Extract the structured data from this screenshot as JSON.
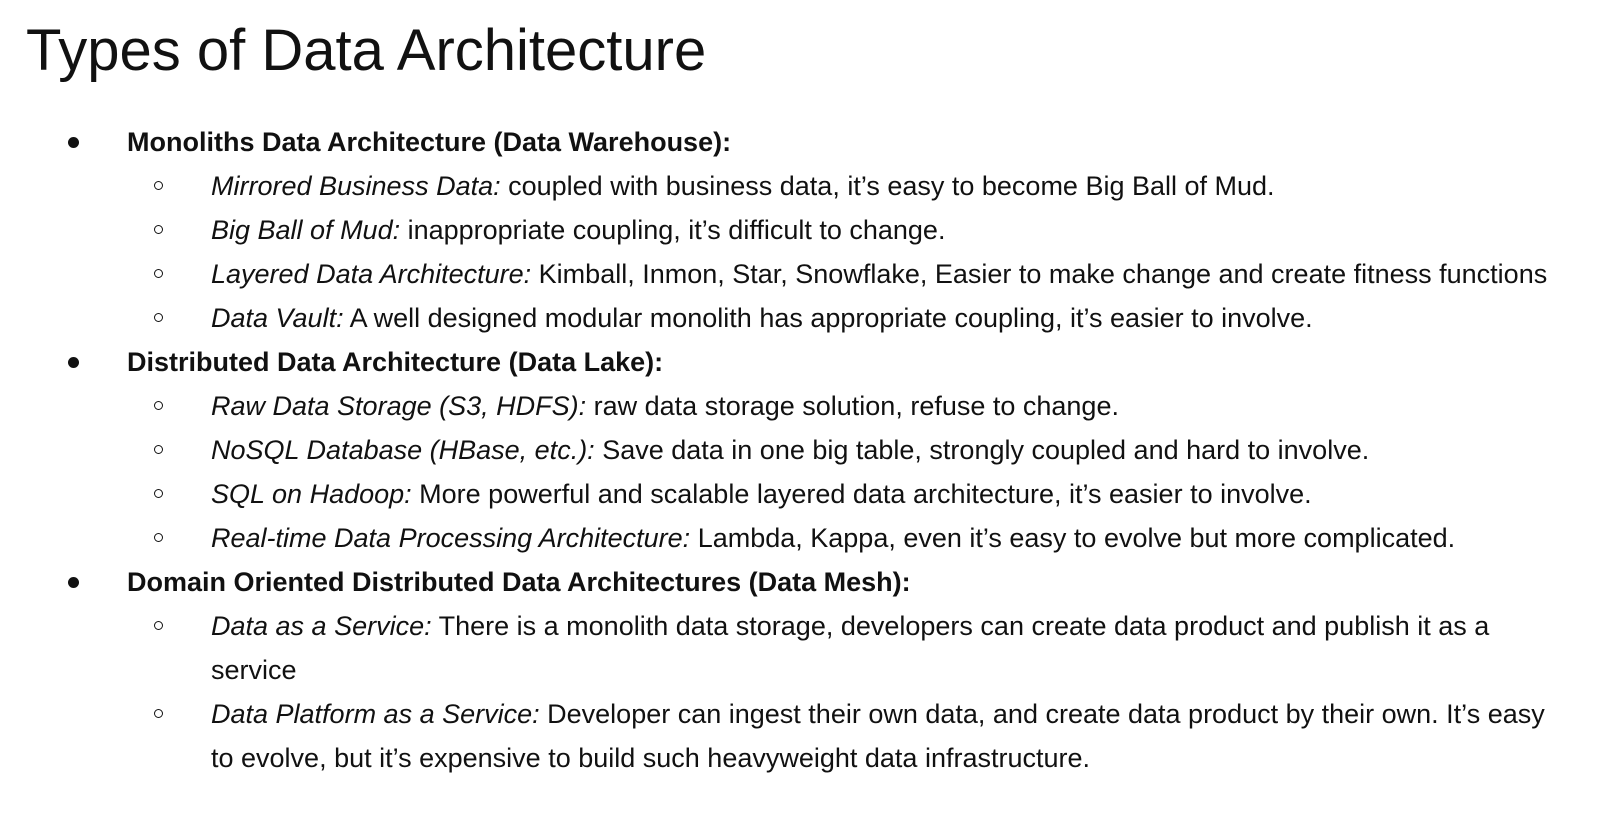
{
  "title": "Types of Data Architecture",
  "sections": [
    {
      "heading": "Monoliths Data Architecture (Data Warehouse):",
      "items": [
        {
          "term": "Mirrored Business Data:",
          "desc": " coupled with business data, it’s easy to become Big Ball of Mud."
        },
        {
          "term": "Big Ball of Mud:",
          "desc": " inappropriate coupling, it’s difficult to change."
        },
        {
          "term": "Layered Data Architecture:",
          "desc": " Kimball, Inmon, Star, Snowflake, Easier to make change and create fitness functions"
        },
        {
          "term": "Data Vault:",
          "desc": " A well designed modular monolith has appropriate coupling, it’s easier to involve."
        }
      ]
    },
    {
      "heading": "Distributed Data Architecture (Data Lake):",
      "items": [
        {
          "term": "Raw Data Storage (S3, HDFS):",
          "desc": " raw data storage solution, refuse to change."
        },
        {
          "term": "NoSQL Database (HBase, etc.):",
          "desc": " Save data in one big table, strongly coupled and hard to involve."
        },
        {
          "term": "SQL on Hadoop:",
          "desc": " More powerful and scalable layered data architecture, it’s easier to involve."
        },
        {
          "term": "Real-time Data Processing Architecture:",
          "desc": " Lambda, Kappa, even it’s easy to evolve but more complicated."
        }
      ]
    },
    {
      "heading": "Domain Oriented Distributed Data Architectures (Data Mesh):",
      "items": [
        {
          "term": "Data as a Service:",
          "desc": " There is a monolith data storage, developers can create data product and publish it as a service"
        },
        {
          "term": "Data Platform as a Service:",
          "desc": " Developer can ingest their own data, and create data product by their own. It’s easy to evolve, but it’s expensive to build such heavyweight data infrastructure."
        }
      ]
    }
  ]
}
